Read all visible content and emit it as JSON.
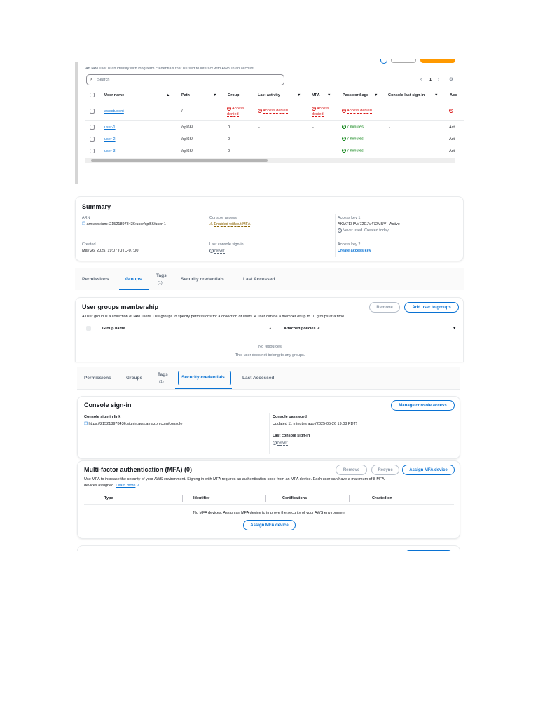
{
  "users_list": {
    "description": "An IAM user is an identity with long-term credentials that is used to interact with AWS in an account",
    "search_placeholder": "Search",
    "page": "1",
    "columns": [
      "User name",
      "Path",
      "Group:",
      "Last activity",
      "MFA",
      "Password age",
      "Console last sign-in",
      "Acc"
    ],
    "rows": [
      {
        "name": "awsstudent",
        "path": "/",
        "groups": "Access denied",
        "last_activity": "Access denied",
        "mfa": "Access denied",
        "password_age": "Access denied",
        "console": "-",
        "acc": ""
      },
      {
        "name": "user-1",
        "path": "/spl66/",
        "groups": "0",
        "last_activity": "-",
        "mfa": "-",
        "password_age": "7 minutes",
        "console": "-",
        "acc": "Acti"
      },
      {
        "name": "user-2",
        "path": "/spl66/",
        "groups": "0",
        "last_activity": "-",
        "mfa": "-",
        "password_age": "7 minutes",
        "console": "-",
        "acc": "Acti"
      },
      {
        "name": "user-3",
        "path": "/spl66/",
        "groups": "0",
        "last_activity": "-",
        "mfa": "-",
        "password_age": "7 minutes",
        "console": "-",
        "acc": "Acti"
      }
    ]
  },
  "summary": {
    "title": "Summary",
    "arn_label": "ARN",
    "arn": "arn:aws:iam::215218978436:user/spl66/user-1",
    "created_label": "Created",
    "created": "May 26, 2025, 19:07 (UTC-07:00)",
    "console_access_label": "Console access",
    "console_access": "Enabled without MFA",
    "last_signin_label": "Last console sign-in",
    "last_signin": "Never",
    "key1_label": "Access key 1",
    "key1": "AKIATEHAM72CJV472MUV - Active",
    "key1_note": "Never used. Created today.",
    "key2_label": "Access key 2",
    "key2_action": "Create access key"
  },
  "tabs": {
    "permissions": "Permissions",
    "groups": "Groups",
    "tags": "Tags",
    "tags_count": "(1)",
    "security": "Security credentials",
    "last_accessed": "Last Accessed"
  },
  "groups_panel": {
    "title": "User groups membership",
    "remove": "Remove",
    "add": "Add user to groups",
    "description": "A user group is a collection of IAM users. Use groups to specify permissions for a collection of users. A user can be a member of up to 10 groups at a time.",
    "col_group": "Group name",
    "col_policies": "Attached policies",
    "empty_title": "No resources",
    "empty_text": "This user does not belong to any groups."
  },
  "console_signin": {
    "title": "Console sign-in",
    "manage": "Manage console access",
    "link_label": "Console sign-in link",
    "link": "https://215218978436.signin.aws.amazon.com/console",
    "password_label": "Console password",
    "password": "Updated 11 minutes ago (2025-05-26 19:08 PDT)",
    "last_label": "Last console sign-in",
    "last": "Never"
  },
  "mfa": {
    "title": "Multi-factor authentication (MFA) (0)",
    "remove": "Remove",
    "resync": "Resync",
    "assign": "Assign MFA device",
    "description1": "Use MFA to increase the security of your AWS environment. Signing in with MFA requires an authentication code from an MFA device. Each user can have a maximum of 8 MFA",
    "description2": "devices assigned.",
    "learn_more": "Learn more",
    "columns": [
      "Type",
      "Identifier",
      "Certifications",
      "Created on"
    ],
    "empty": "No MFA devices. Assign an MFA device to improve the security of your AWS environment",
    "empty_button": "Assign MFA device"
  }
}
